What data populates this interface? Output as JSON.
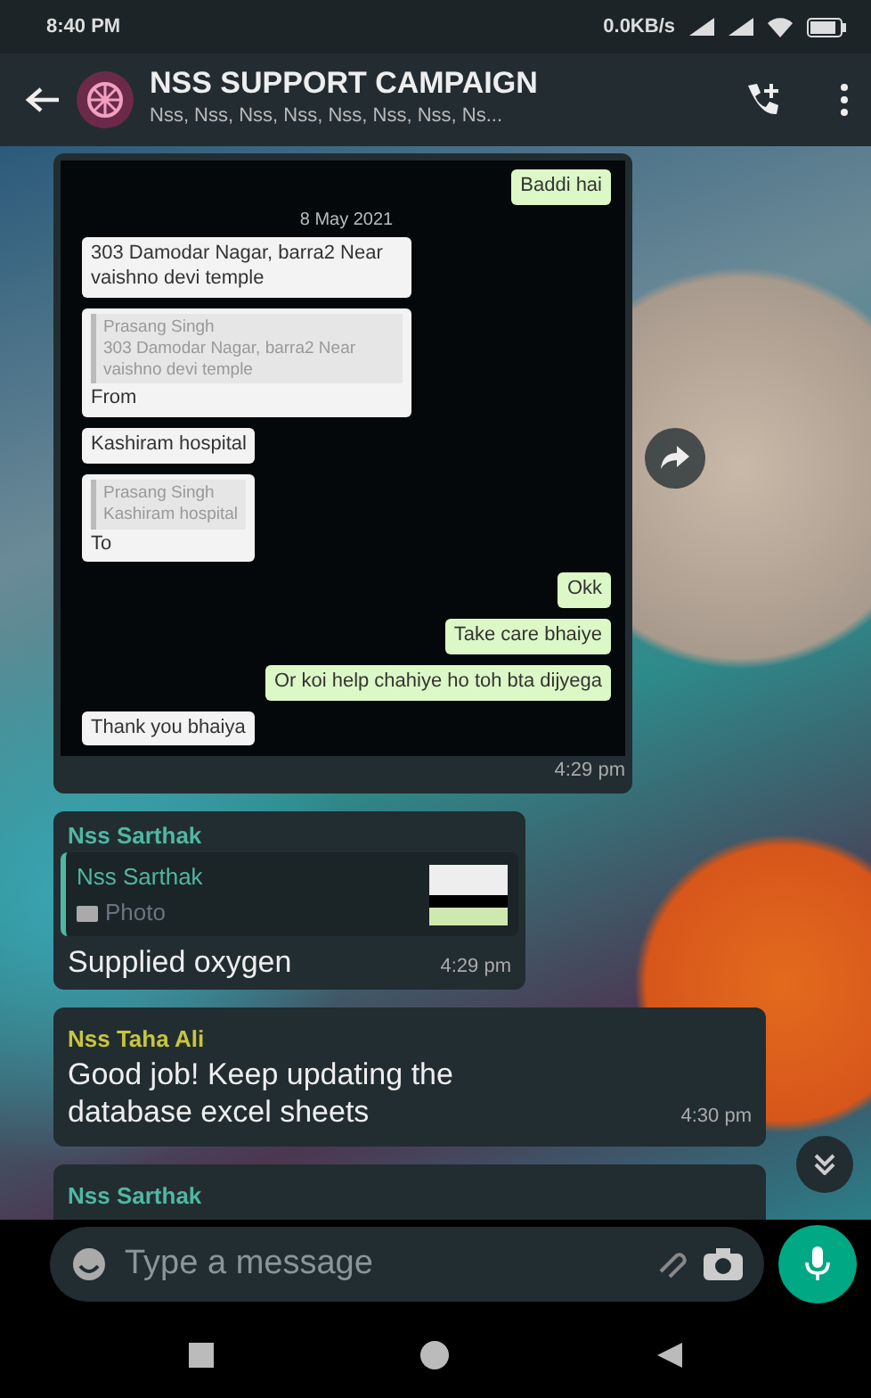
{
  "status_bar": {
    "time": "8:40 PM",
    "speed": "0.0KB/s"
  },
  "header": {
    "title": "NSS SUPPORT CAMPAIGN",
    "subtitle": "Nss, Nss, Nss, Nss, Nss, Nss, Nss, Ns..."
  },
  "messages": [
    {
      "kind": "image",
      "time": "4:29 pm",
      "screenshot": [
        {
          "kind": "out",
          "text": "Baddi hai"
        },
        {
          "kind": "date",
          "text": "8 May 2021"
        },
        {
          "kind": "in",
          "text": "303 Damodar Nagar, barra2 Near vaishno devi temple"
        },
        {
          "kind": "in",
          "quote_sender": "Prasang Singh",
          "quote_text": "303 Damodar Nagar, barra2 Near vaishno devi temple",
          "text": "From"
        },
        {
          "kind": "in",
          "text": "Kashiram hospital"
        },
        {
          "kind": "in",
          "quote_sender": "Prasang Singh",
          "quote_text": "Kashiram hospital",
          "text": "To"
        },
        {
          "kind": "out",
          "text": "Okk"
        },
        {
          "kind": "out",
          "text": "Take care bhaiye"
        },
        {
          "kind": "out",
          "text": "Or koi help chahiye ho toh bta dijyega"
        },
        {
          "kind": "in",
          "text": "Thank you bhaiya"
        }
      ]
    },
    {
      "kind": "reply",
      "sender": "Nss Sarthak",
      "color": "#4fb7a3",
      "quote_sender": "Nss Sarthak",
      "quote_text": "Photo",
      "text": "Supplied oxygen",
      "time": "4:29 pm"
    },
    {
      "kind": "text",
      "sender": "Nss Taha Ali",
      "color": "#c8c53c",
      "text": "Good job! Keep updating the database excel sheets",
      "time": "4:30 pm"
    },
    {
      "kind": "partial",
      "sender": "Nss Sarthak",
      "color": "#4fb7a3"
    }
  ],
  "composer": {
    "placeholder": "Type a message"
  }
}
